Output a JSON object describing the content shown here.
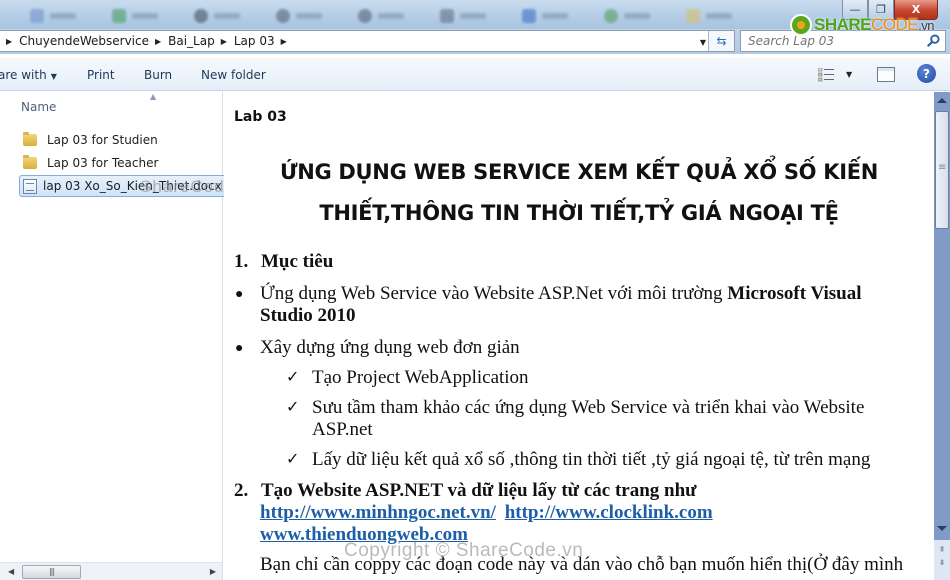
{
  "window": {
    "controls": {
      "minimize": "—",
      "maximize": "❐",
      "close": "X"
    },
    "watermark_logo": {
      "brand": "SHARE",
      "brand2": "CODE",
      "suffix": ".vn"
    }
  },
  "address_bar": {
    "breadcrumbs": [
      "ChuyendeWebservice",
      "Bai_Lap",
      "Lap 03"
    ],
    "refresh_icon": "refresh-icon"
  },
  "search": {
    "placeholder": "Search Lap 03"
  },
  "toolbar": {
    "share_label": "are with",
    "print_label": "Print",
    "burn_label": "Burn",
    "new_folder_label": "New folder",
    "help_label": "?"
  },
  "file_list": {
    "column_header": "Name",
    "items": [
      {
        "name": "Lap 03 for Studien",
        "type": "folder"
      },
      {
        "name": "Lap 03 for Teacher",
        "type": "folder"
      },
      {
        "name": "lap 03 Xo_So_Kien_Thiet.docx",
        "type": "document",
        "selected": true
      }
    ],
    "watermark": "ShareCode.vn"
  },
  "preview": {
    "lab_label": "Lab 03",
    "title_line1": "ỨNG DỤNG WEB SERVICE XEM KẾT QUẢ XỔ SỐ KIẾN",
    "title_line2": "THIẾT,THÔNG TIN THỜI TIẾT,TỶ GIÁ NGOẠI TỆ",
    "section1": {
      "number": "1.",
      "heading": "Mục tiêu"
    },
    "bullets": [
      {
        "text": "Ứng dụng Web Service vào Website ASP.Net với môi trường ",
        "bold_part": "Microsoft Visual Studio 2010"
      },
      {
        "text": "Xây dựng ứng dụng web đơn giản"
      }
    ],
    "checks": [
      "Tạo Project WebApplication",
      "Sưu tầm tham khảo các ứng dụng Web Service và triển khai vào Website",
      "ASP.net",
      "Lấy  dữ liệu kết quả xổ số ,thông tin thời tiết ,tỷ giá ngoại tệ, từ trên mạng"
    ],
    "section2": {
      "number": "2.",
      "heading": "Tạo Website ASP.NET và dữ liệu lấy từ các trang như",
      "links": [
        "http://www.minhngoc.net.vn/",
        "http://www.clocklink.com",
        "www.thienduongweb.com"
      ]
    },
    "paragraph": "Bạn chỉ cần coppy các đoạn code này và dán vào chỗ bạn muốn hiển thị(Ở đây mình",
    "copyright_watermark": "Copyright © ShareCode.vn"
  }
}
